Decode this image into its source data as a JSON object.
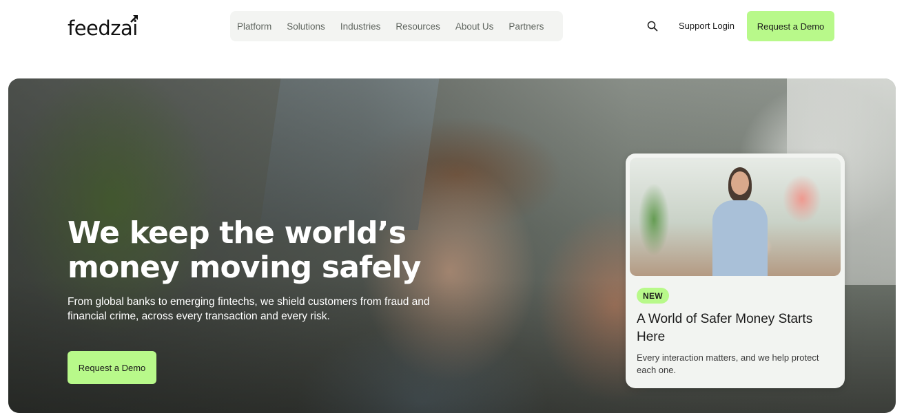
{
  "header": {
    "logo_text": "feedzai",
    "nav": [
      {
        "label": "Platform"
      },
      {
        "label": "Solutions"
      },
      {
        "label": "Industries"
      },
      {
        "label": "Resources"
      },
      {
        "label": "About Us"
      },
      {
        "label": "Partners"
      }
    ],
    "search_icon": "search-icon",
    "support_login": "Support Login",
    "request_demo": "Request a Demo"
  },
  "hero": {
    "title": "We keep the world’s money moving safely",
    "subtitle": "From global banks to emerging fintechs, we shield customers from fraud and financial crime, across every transaction and every risk.",
    "cta": "Request a Demo"
  },
  "card": {
    "badge": "NEW",
    "title": "A World of Safer Money Starts Here",
    "description": "Every interaction matters, and we help protect each one."
  },
  "colors": {
    "accent": "#b8f98a",
    "nav_bg": "#f3f4f2",
    "card_bg": "#f2f4f1"
  }
}
